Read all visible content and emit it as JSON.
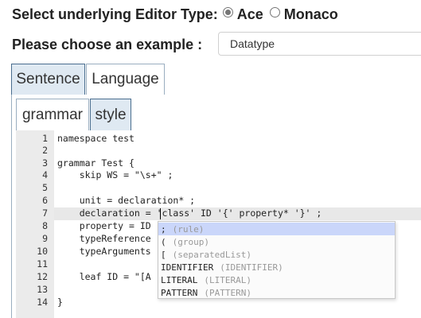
{
  "editor_type": {
    "label": "Select underlying Editor Type:",
    "options": [
      {
        "label": "Ace",
        "checked": true
      },
      {
        "label": "Monaco",
        "checked": false
      }
    ]
  },
  "example": {
    "label": "Please choose an example :",
    "selected": "Datatype"
  },
  "top_tabs": [
    {
      "label": "Sentence"
    },
    {
      "label": "Language"
    }
  ],
  "sub_tabs": [
    {
      "label": "grammar"
    },
    {
      "label": "style"
    }
  ],
  "editor": {
    "lines": [
      {
        "n": "1",
        "text": "namespace test"
      },
      {
        "n": "2",
        "text": ""
      },
      {
        "n": "3",
        "text": "grammar Test {"
      },
      {
        "n": "4",
        "text": "    skip WS = \"\\s+\" ;"
      },
      {
        "n": "5",
        "text": ""
      },
      {
        "n": "6",
        "text": "    unit = declaration* ;"
      },
      {
        "n": "7",
        "text": "    declaration = 'class' ID '{' property* '}' ;"
      },
      {
        "n": "8",
        "text": "    property = ID"
      },
      {
        "n": "9",
        "text": "    typeReference"
      },
      {
        "n": "10",
        "text": "    typeArguments"
      },
      {
        "n": "11",
        "text": ""
      },
      {
        "n": "12",
        "text": "    leaf ID = \"[A"
      },
      {
        "n": "13",
        "text": ""
      },
      {
        "n": "14",
        "text": "}"
      }
    ]
  },
  "autocomplete": {
    "items": [
      {
        "value": ";",
        "meta": "(rule)"
      },
      {
        "value": "(",
        "meta": "(group)"
      },
      {
        "value": "[",
        "meta": "(separatedList)"
      },
      {
        "value": "IDENTIFIER",
        "meta": "(IDENTIFIER)"
      },
      {
        "value": "LITERAL",
        "meta": "(LITERAL)"
      },
      {
        "value": "PATTERN",
        "meta": "(PATTERN)"
      }
    ]
  }
}
